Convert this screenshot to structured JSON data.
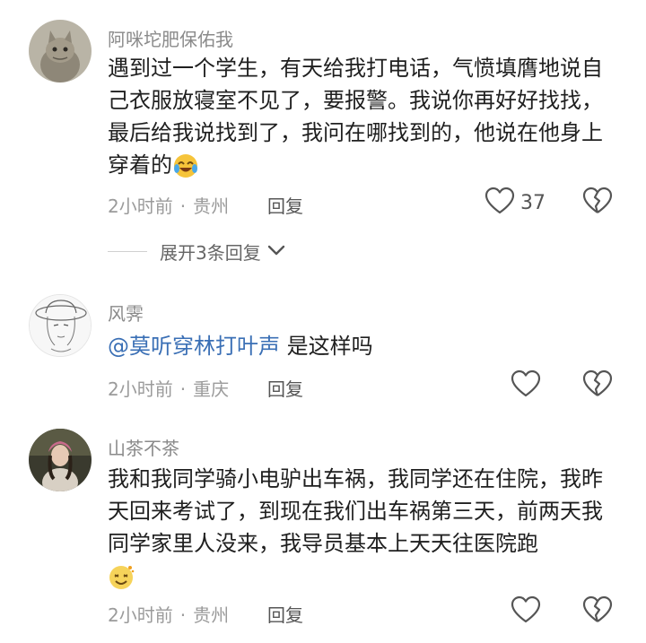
{
  "comments": [
    {
      "username": "阿咪坨肥保佑我",
      "text": "遇到过一个学生，有天给我打电话，气愤填膺地说自己衣服放寝室不见了，要报警。我说你再好好找找，最后给我说找到了，我问在哪找到的，他说在他身上穿着的",
      "emoji": "laughing-tears-emoji",
      "time": "2小时前",
      "location": "贵州",
      "reply_label": "回复",
      "likes": "37"
    },
    {
      "username": "风霁",
      "mention": "@莫听穿林打叶声",
      "text": " 是这样吗",
      "time": "2小时前",
      "location": "重庆",
      "reply_label": "回复"
    },
    {
      "username": "山茶不茶",
      "text": "我和我同学骑小电驴出车祸，我同学还在住院，我昨天回来考试了，到现在我们出车祸第三天，前两天我同学家里人没来，我导员基本上天天往医院跑",
      "emoji": "dizzy-smile-emoji",
      "time": "2小时前",
      "location": "贵州",
      "reply_label": "回复"
    }
  ],
  "expand_replies_label": "展开3条回复",
  "dot": "·",
  "icons": {
    "like": "heart-outline-icon",
    "dislike": "broken-heart-icon",
    "expand": "chevron-down-icon"
  }
}
